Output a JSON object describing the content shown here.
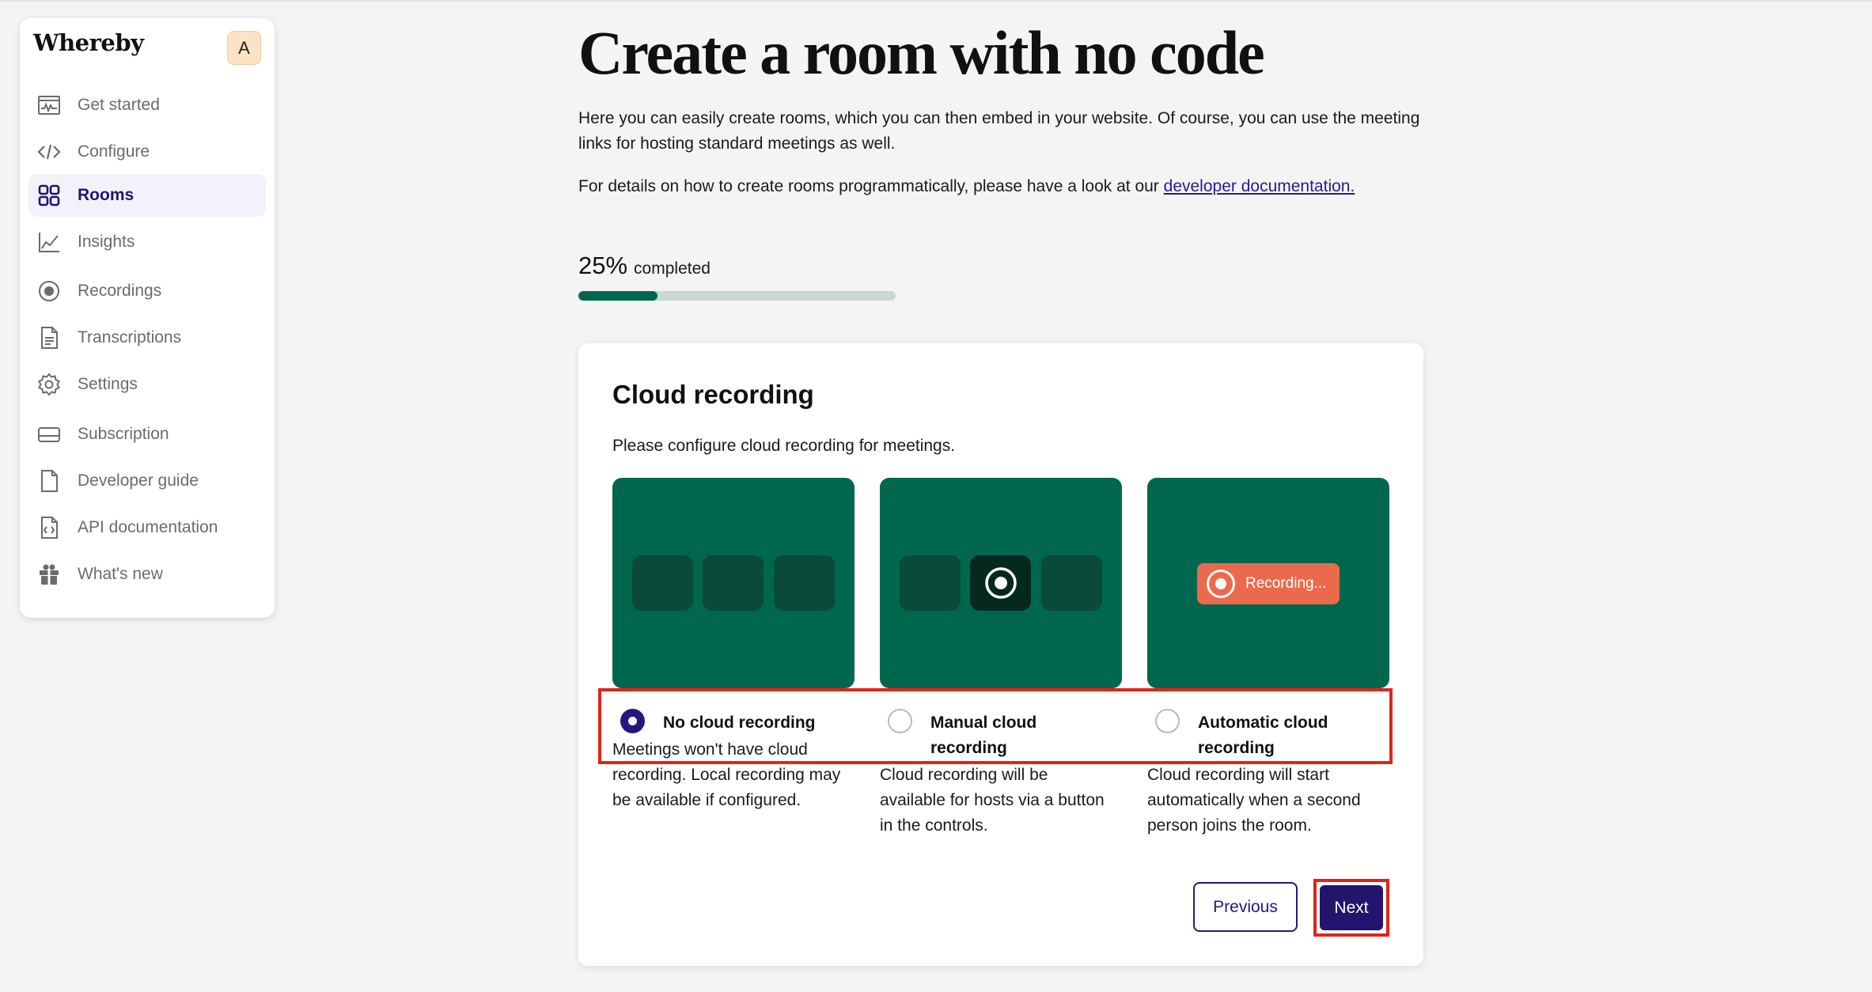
{
  "app": {
    "logo": "Whereby",
    "avatar_initial": "A"
  },
  "sidebar": {
    "items": [
      {
        "label": "Get started",
        "icon": "activity-chart-icon",
        "active": false
      },
      {
        "label": "Configure",
        "icon": "code-icon",
        "active": false
      },
      {
        "label": "Rooms",
        "icon": "grid-icon",
        "active": true
      },
      {
        "label": "Insights",
        "icon": "line-chart-icon",
        "active": false
      },
      {
        "label": "Recordings",
        "icon": "record-icon",
        "active": false
      },
      {
        "label": "Transcriptions",
        "icon": "document-text-icon",
        "active": false
      },
      {
        "label": "Settings",
        "icon": "gear-icon",
        "active": false
      },
      {
        "label": "Subscription",
        "icon": "card-icon",
        "active": false
      },
      {
        "label": "Developer guide",
        "icon": "file-icon",
        "active": false
      },
      {
        "label": "API documentation",
        "icon": "code-file-icon",
        "active": false
      },
      {
        "label": "What's new",
        "icon": "gift-icon",
        "active": false
      }
    ]
  },
  "main": {
    "title": "Create a room with no code",
    "intro": "Here you can easily create rooms, which you can then embed in your website. Of course, you can use the meeting links for hosting standard meetings as well.",
    "details_prefix": "For details on how to create rooms programmatically, please have a look at our ",
    "details_link": "developer documentation.",
    "progress": {
      "percent_label": "25%",
      "completed_label": "completed",
      "value": 0.25
    }
  },
  "card": {
    "title": "Cloud recording",
    "subtitle": "Please configure cloud recording for meetings.",
    "recording_badge": "Recording...",
    "options": [
      {
        "label": "No cloud recording",
        "description": "Meetings won't have cloud recording. Local recording may be available if configured.",
        "selected": true
      },
      {
        "label": "Manual cloud recording",
        "description": "Cloud recording will be available for hosts via a button in the controls.",
        "selected": false
      },
      {
        "label": "Automatic cloud recording",
        "description": "Cloud recording will start automatically when a second person joins the room.",
        "selected": false
      }
    ],
    "previous_label": "Previous",
    "next_label": "Next"
  },
  "colors": {
    "brand_purple": "#24146e",
    "brand_green": "#00674f",
    "recording_orange": "#ec6a4c",
    "highlight_red": "#e2231a"
  }
}
